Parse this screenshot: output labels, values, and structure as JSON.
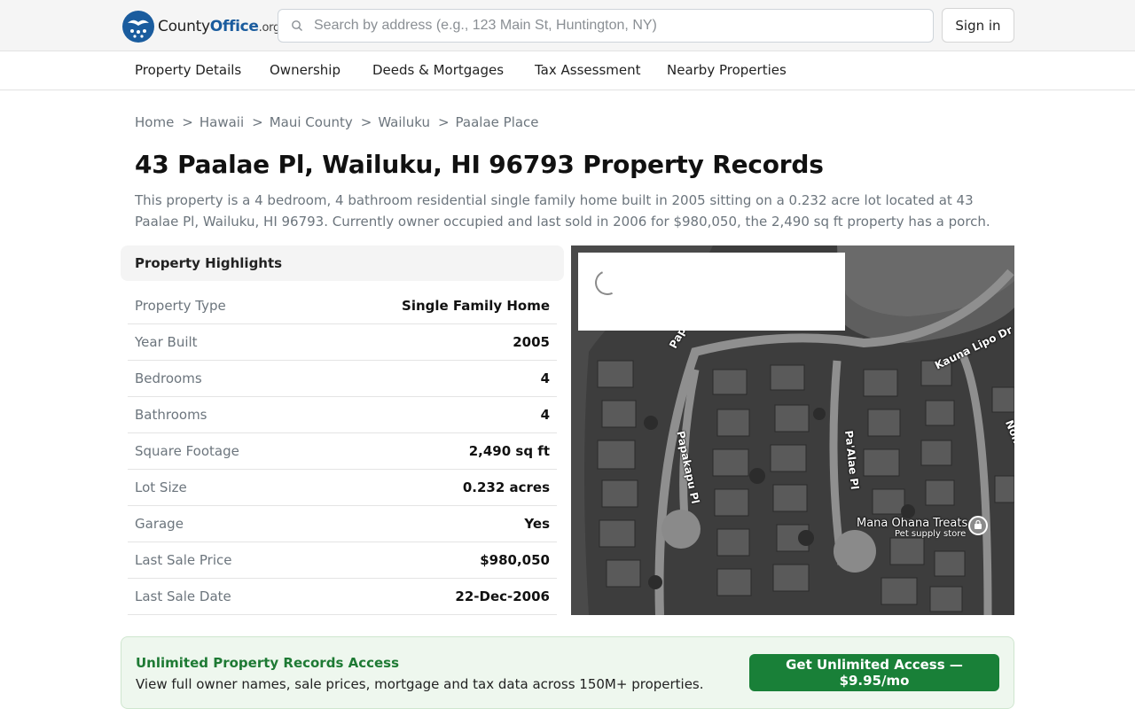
{
  "header": {
    "logo_main": "County",
    "logo_bold": "Office",
    "logo_org": ".org",
    "search_placeholder": "Search by address (e.g., 123 Main St, Huntington, NY)",
    "signin_label": "Sign in"
  },
  "subnav": [
    "Property Details",
    "Ownership",
    "Deeds & Mortgages",
    "Tax Assessment",
    "Nearby Properties"
  ],
  "breadcrumb": [
    "Home",
    "Hawaii",
    "Maui County",
    "Wailuku",
    "Paalae Place"
  ],
  "page": {
    "title": "43 Paalae Pl, Wailuku, HI 96793 Property Records",
    "description": "This property is a 4 bedroom, 4 bathroom residential single family home built in 2005 sitting on a 0.232 acre lot located at 43 Paalae Pl, Wailuku, HI 96793. Currently owner occupied and last sold in 2006 for $980,050, the 2,490 sq ft property has a porch."
  },
  "highlights": {
    "title": "Property Highlights",
    "rows": [
      {
        "label": "Property Type",
        "value": "Single Family Home"
      },
      {
        "label": "Year Built",
        "value": "2005"
      },
      {
        "label": "Bedrooms",
        "value": "4"
      },
      {
        "label": "Bathrooms",
        "value": "4"
      },
      {
        "label": "Square Footage",
        "value": "2,490 sq ft"
      },
      {
        "label": "Lot Size",
        "value": "0.232 acres"
      },
      {
        "label": "Garage",
        "value": "Yes"
      },
      {
        "label": "Last Sale Price",
        "value": "$980,050"
      },
      {
        "label": "Last Sale Date",
        "value": "22-Dec-2006"
      }
    ]
  },
  "map": {
    "labels": [
      "Papakapu Pl",
      "Papakapu Pl",
      "Pa'Alae Pl",
      "Kauna Lipo Dr",
      "Noho'Ana Pl"
    ],
    "poi_name": "Mana Ohana Treats",
    "poi_type": "Pet supply store"
  },
  "cta": {
    "title": "Unlimited Property Records Access",
    "text": "View full owner names, sale prices, mortgage and tax data across 150M+ properties.",
    "button": "Get Unlimited Access — $9.95/mo"
  },
  "colors": {
    "brand_blue": "#1a5c9e",
    "cta_green": "#198038",
    "cta_title_green": "#1e7a34"
  }
}
